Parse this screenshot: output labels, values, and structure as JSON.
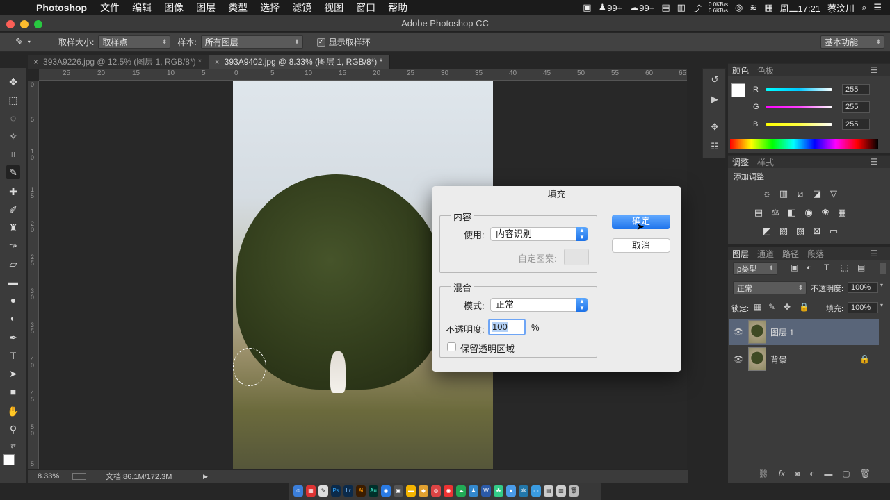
{
  "menubar": {
    "app_name": "Photoshop",
    "items": [
      "文件",
      "编辑",
      "图像",
      "图层",
      "类型",
      "选择",
      "滤镜",
      "视图",
      "窗口",
      "帮助"
    ],
    "qq_badge": "99+",
    "wechat_badge": "99+",
    "net_up": "0.0KB/s",
    "net_down": "0.6KB/s",
    "clock": "周二17:21",
    "user": "蔡汶川"
  },
  "window": {
    "title": "Adobe Photoshop CC"
  },
  "options": {
    "sample_size_label": "取样大小:",
    "sample_size_value": "取样点",
    "sample_label": "样本:",
    "sample_value": "所有图层",
    "show_ring_label": "显示取样环",
    "workspace": "基本功能"
  },
  "tabs": [
    {
      "label": "393A9226.jpg @ 12.5% (图层 1, RGB/8*) *"
    },
    {
      "label": "393A9402.jpg @ 8.33% (图层 1, RGB/8*) *"
    }
  ],
  "ruler_top": [
    "25",
    "20",
    "15",
    "10",
    "5",
    "0",
    "5",
    "10",
    "15",
    "20",
    "25",
    "30",
    "35",
    "40",
    "45",
    "50",
    "55",
    "60",
    "65"
  ],
  "ruler_left": [
    "0",
    "5",
    "1 0",
    "1 5",
    "2 0",
    "2 5",
    "3 0",
    "3 5",
    "4 0",
    "4 5",
    "5 0",
    "5"
  ],
  "status": {
    "zoom": "8.33%",
    "doc": "文档:86.1M/172.3M"
  },
  "color_panel": {
    "tabs": [
      "颜色",
      "色板"
    ],
    "r_label": "R",
    "g_label": "G",
    "b_label": "B",
    "r": "255",
    "g": "255",
    "b": "255",
    "accent_r": "#00c8ff",
    "accent_g": "#ff40ff",
    "accent_b": "#ffff40"
  },
  "adjust_panel": {
    "tabs": [
      "调整",
      "样式"
    ],
    "add_label": "添加调整"
  },
  "layers_panel": {
    "tabs": [
      "图层",
      "通道",
      "路径",
      "段落"
    ],
    "filter_label": "ρ类型",
    "blend_mode": "正常",
    "opacity_label": "不透明度:",
    "opacity": "100%",
    "lock_label": "锁定:",
    "fill_label": "填充:",
    "fill": "100%",
    "layers": [
      {
        "name": "图层 1",
        "selected": true
      },
      {
        "name": "背景",
        "locked": true
      }
    ]
  },
  "dialog": {
    "title": "填充",
    "content_group": "内容",
    "use_label": "使用:",
    "use_value": "内容识别",
    "custom_pattern_label": "自定图案:",
    "blend_group": "混合",
    "mode_label": "模式:",
    "mode_value": "正常",
    "opacity_label": "不透明度:",
    "opacity_value": "100",
    "percent": "%",
    "preserve_label": "保留透明区域",
    "ok": "确定",
    "cancel": "取消"
  }
}
